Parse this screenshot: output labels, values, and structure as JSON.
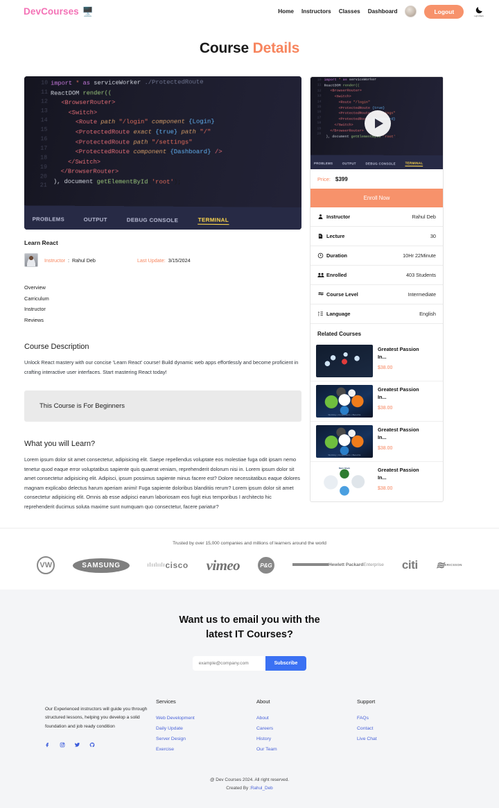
{
  "header": {
    "brand": "DevCourses",
    "brand_icon": "desktop-computer-icon",
    "nav": [
      {
        "label": "Home"
      },
      {
        "label": "Instructors"
      },
      {
        "label": "Classes"
      },
      {
        "label": "Dashboard"
      }
    ],
    "logout_label": "Logout",
    "theme_toggle_label": "Light/Dark",
    "theme_icon": "moon-icon"
  },
  "page": {
    "title_primary": "Course",
    "title_accent": "Details"
  },
  "code_image": {
    "gutter": [
      "10",
      "11",
      "12",
      "13",
      "14",
      "15",
      "16",
      "17",
      "18",
      "19",
      "20",
      "21"
    ],
    "terminal_tabs": [
      "PROBLEMS",
      "OUTPUT",
      "DEBUG CONSOLE",
      "TERMINAL"
    ],
    "active_terminal_tab": "TERMINAL"
  },
  "course": {
    "title": "Learn React",
    "instructor_label": "Instructor",
    "instructor_sep": ":",
    "instructor_name": "Rahul Deb",
    "last_update_label": "Last Update:",
    "last_update_value": "3/15/2024",
    "tabs": [
      {
        "label": "Overview"
      },
      {
        "label": "Carriculum"
      },
      {
        "label": "Instructor"
      },
      {
        "label": "Reviews"
      }
    ],
    "description_heading": "Course Description",
    "description_text": "Unlock React mastery with our concise 'Learn React' course! Build dynamic web apps effortlessly and become proficient in crafting interactive user interfaces. Start mastering React today!",
    "beginners_note": "This Course is For Beginners",
    "learn_heading": "What you will Learn?",
    "learn_text": "Lorem ipsum dolor sit amet consectetur, adipisicing elit. Saepe repellendus voluptate eos molestiae fuga odit ipsam nemo tenetur quod eaque error voluptatibus sapiente quis quaerat veniam, reprehenderit dolorum nisi in. Lorem ipsum dolor sit amet consectetur adipisicing elit. Adipisci, ipsum possimus sapiente minus facere est? Dolore necessitatibus eaque dolores magnam explicabo delectus harum aperiam animi! Fuga sapiente doloribus blanditiis rerum? Lorem ipsum dolor sit amet consectetur adipisicing elit. Omnis ab esse adipisci earum laboriosam eos fugit eius temporibus I architecto hic reprehenderit ducimus soluta maxime sunt numquam quo consectetur, facere pariatur?"
  },
  "sidebar": {
    "play_icon": "play-button-icon",
    "price_label": "Price:",
    "price_value": "$399",
    "enroll_label": "Enroll Now",
    "info_rows": [
      {
        "icon": "user-icon",
        "key": "Instructor",
        "value": "Rahul Deb"
      },
      {
        "icon": "book-icon",
        "key": "Lecture",
        "value": "30"
      },
      {
        "icon": "clock-icon",
        "key": "Duration",
        "value": "10Hr 22Minute"
      },
      {
        "icon": "users-icon",
        "key": "Enrolled",
        "value": "403 Students"
      },
      {
        "icon": "signal-icon",
        "key": "Course Level",
        "value": "Intermediate"
      },
      {
        "icon": "language-icon",
        "key": "Language",
        "value": "English"
      }
    ],
    "related_title": "Related Courses",
    "related": [
      {
        "name": "Greatest Passion In...",
        "price": "$38.00",
        "thumb": "t-dark",
        "thumb_caption": "",
        "thumb_top": ""
      },
      {
        "name": "Greatest Passion In...",
        "price": "$38.00",
        "thumb": "t-mern",
        "thumb_caption": "Working | Components | Benefits",
        "thumb_top": ""
      },
      {
        "name": "Greatest Passion In...",
        "price": "$38.00",
        "thumb": "t-mern",
        "thumb_caption": "Working | Components | Benefits",
        "thumb_top": ""
      },
      {
        "name": "Greatest Passion In...",
        "price": "$38.00",
        "thumb": "t-white",
        "thumb_caption": "",
        "thumb_top": "Mern Stack"
      }
    ]
  },
  "trusted": {
    "text": "Trusted by over 15,000 companies and millions of learners around the world",
    "logos": [
      {
        "name": "volkswagen-logo",
        "text": "VW"
      },
      {
        "name": "samsung-logo",
        "text": "SAMSUNG"
      },
      {
        "name": "cisco-logo",
        "text": "cisco"
      },
      {
        "name": "vimeo-logo",
        "text": "vimeo"
      },
      {
        "name": "pg-logo",
        "text": "P&G"
      },
      {
        "name": "hpe-logo",
        "text": "Hewlett Packard",
        "text2": "Enterprise"
      },
      {
        "name": "citi-logo",
        "text": "citi"
      },
      {
        "name": "ericsson-logo",
        "text": "ERICSSON"
      }
    ]
  },
  "newsletter": {
    "heading_line1": "Want us to email you with the",
    "heading_line2": "latest IT Courses?",
    "input_placeholder": "example@company.com",
    "input_value": "",
    "button_label": "Subscribe"
  },
  "footer": {
    "about_text": "Our Experienced instructors will guide you through structured lessons, helping you develop a solid foundation and job ready condition",
    "socials": [
      {
        "name": "facebook-icon"
      },
      {
        "name": "instagram-icon"
      },
      {
        "name": "twitter-icon"
      },
      {
        "name": "github-icon"
      }
    ],
    "columns": [
      {
        "title": "Services",
        "links": [
          {
            "label": "Web Development"
          },
          {
            "label": "Daily Update"
          },
          {
            "label": "Server Design"
          },
          {
            "label": "Exercise"
          }
        ]
      },
      {
        "title": "About",
        "links": [
          {
            "label": "About"
          },
          {
            "label": "Careers"
          },
          {
            "label": "History"
          },
          {
            "label": "Our Team"
          }
        ]
      },
      {
        "title": "Support",
        "links": [
          {
            "label": "FAQs"
          },
          {
            "label": "Contact"
          },
          {
            "label": "Live Chat"
          }
        ]
      }
    ],
    "copyright_line1": "@ Dev Courses 2024. All right reserved.",
    "copyright_prefix": "Created By :",
    "copyright_author": "Rahul_Deb"
  },
  "colors": {
    "accent_orange": "#f7855e",
    "button_orange": "#f7926b",
    "brand_pink": "#f472b6",
    "link_blue": "#4a63d8",
    "subscribe_blue": "#3b71f3"
  }
}
